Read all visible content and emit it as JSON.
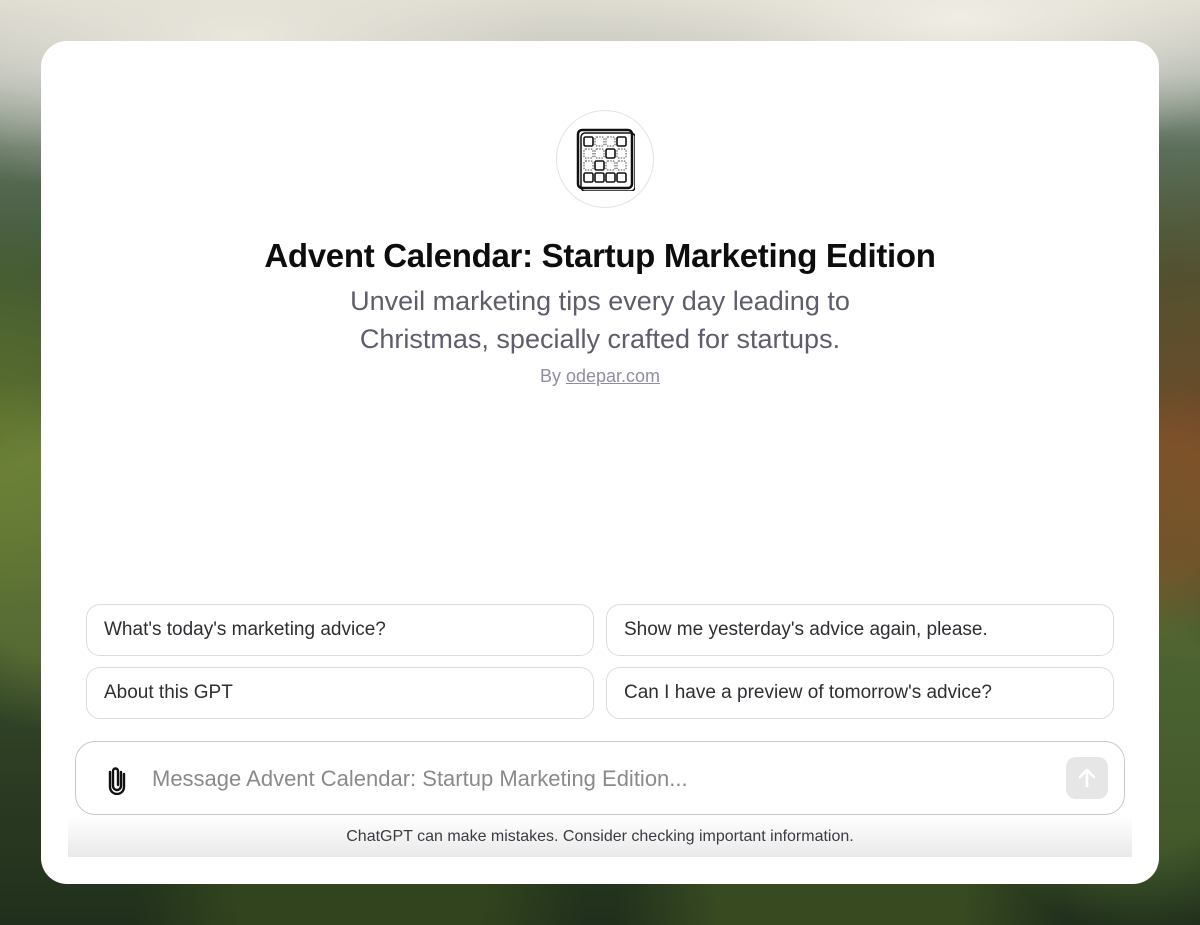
{
  "gpt": {
    "name": "Advent Calendar: Startup Marketing Edition",
    "description": "Unveil marketing tips every day leading to Christmas, specially crafted for startups.",
    "by_prefix": "By",
    "author": "odepar.com",
    "logo_icon": "calendar-grid-icon"
  },
  "starters": [
    "What's today's marketing advice?",
    "Show me yesterday's advice again, please.",
    "About this GPT",
    "Can I have a preview of tomorrow's advice?"
  ],
  "composer": {
    "placeholder": "Message Advent Calendar: Startup Marketing Edition...",
    "attach_icon": "paperclip-icon",
    "send_icon": "arrow-up-icon"
  },
  "footer": {
    "disclaimer": "ChatGPT can make mistakes. Consider checking important information."
  },
  "colors": {
    "card": "#ffffff",
    "title": "#0d0d0d",
    "subtitle": "#5d5d6b",
    "send_disabled": "#e6e6e6"
  }
}
